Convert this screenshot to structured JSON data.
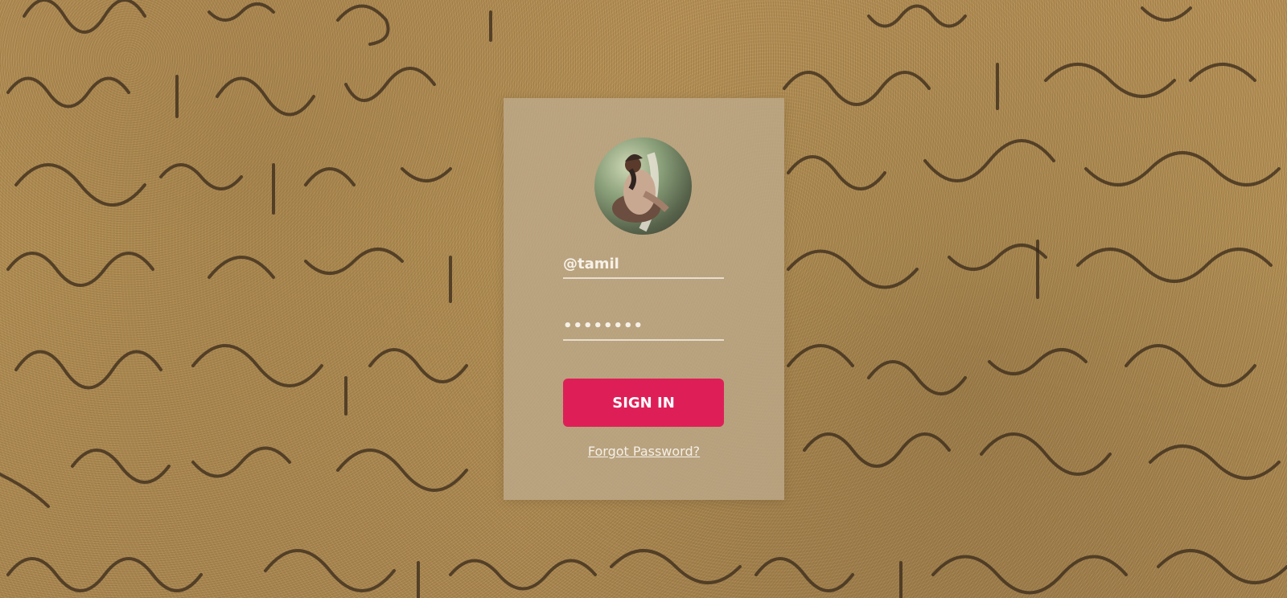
{
  "background": {
    "description_icon": "carved-stone-script-texture"
  },
  "login": {
    "avatar_icon": "profile-avatar-icon",
    "username_value": "@tamil",
    "password_value": "••••••••",
    "sign_in_label": "SIGN IN",
    "forgot_password_label": "Forgot Password?",
    "button_color": "#de1f57"
  }
}
